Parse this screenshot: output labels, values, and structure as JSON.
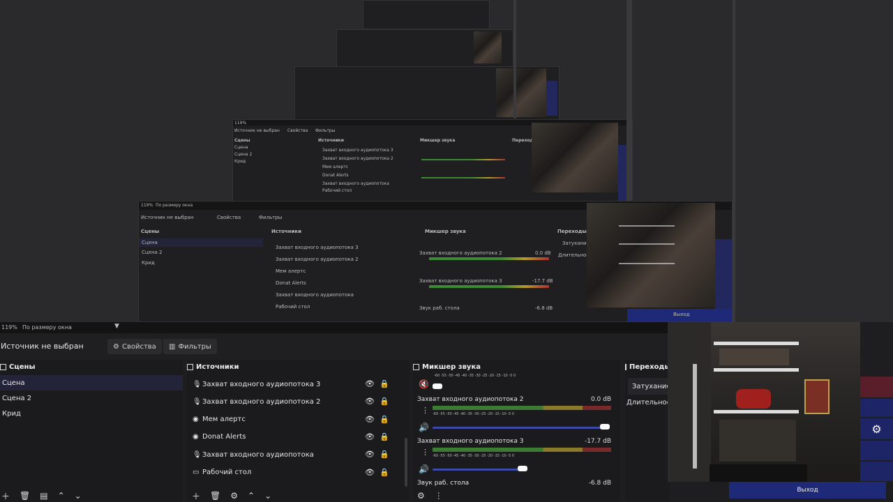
{
  "topbar": {
    "zoom": "119%",
    "zoom_mode": "По размеру окна"
  },
  "source_bar": {
    "no_source": "Источник не выбран",
    "properties_label": "Свойства",
    "filters_label": "Фильтры"
  },
  "scenes": {
    "title": "Сцены",
    "items": [
      "Сцена",
      "Сцена 2",
      "Крид"
    ]
  },
  "sources": {
    "title": "Источники",
    "items": [
      {
        "label": "Захват входного аудиопотока 3",
        "icon": "mic-icon"
      },
      {
        "label": "Захват входного аудиопотока 2",
        "icon": "mic-icon"
      },
      {
        "label": "Мем алертс",
        "icon": "globe-icon"
      },
      {
        "label": "Donat Alerts",
        "icon": "globe-icon"
      },
      {
        "label": "Захват входного аудиопотока",
        "icon": "mic-icon"
      },
      {
        "label": "Рабочий стол",
        "icon": "monitor-icon"
      }
    ]
  },
  "mixer": {
    "title": "Микшер звука",
    "ticks": "-60  -55  -50  -45  -40  -35  -30  -25  -20  -15  -10  -5  0",
    "channels": [
      {
        "name": "Захват входного аудиопотока 2",
        "db": "0.0 dB",
        "volume": 1.0
      },
      {
        "name": "Захват входного аудиопотока 3",
        "db": "-17.7 dB",
        "volume": 0.5
      },
      {
        "name": "Звук раб. стола",
        "db": "-6.8 dB"
      }
    ]
  },
  "transitions": {
    "title": "Переходы",
    "fade": "Затухание",
    "duration": "Длительность"
  },
  "controls": {
    "exit": "Выход"
  },
  "echo": {
    "zoom": "119%",
    "zoom_mode": "По размеру окна",
    "no_source": "Источник не выбран",
    "properties": "Свойства",
    "filters": "Фильтры",
    "scenes_title": "Сцены",
    "sources_title": "Источники",
    "mixer_title": "Микшер звука",
    "trans_title": "Переходы",
    "scene_items": [
      "Сцена",
      "Сцена 2",
      "Крид"
    ],
    "source_items": [
      "Захват входного аудиопотока 3",
      "Захват входного аудиопотока 2",
      "Мем алертс",
      "Donat Alerts",
      "Захват входного аудиопотока",
      "Рабочий стол"
    ],
    "ch1": "Захват входного аудиопотока 2",
    "ch1_db": "0.0 dB",
    "ch2": "Захват входного аудиопотока 3",
    "ch2_db": "-17.7 dB",
    "ch3": "Звук раб. стола",
    "ch3_db": "-6.8 dB",
    "fade": "Затухание",
    "duration": "Длительность",
    "exit": "Выход"
  },
  "colors": {
    "accent_blue": "#1e2a78",
    "selected_row": "#23243a",
    "meter_green": "#3d7a34",
    "meter_yellow": "#8b7a2a",
    "meter_red": "#7a2a2a"
  }
}
